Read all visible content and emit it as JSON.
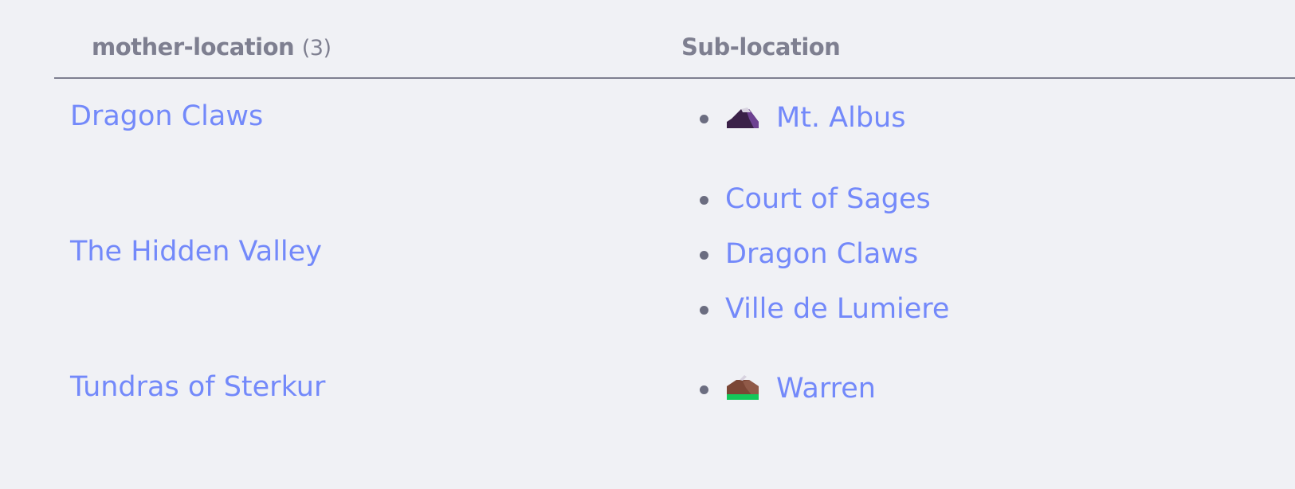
{
  "table": {
    "headers": {
      "mother": "mother-location",
      "mother_count": "(3)",
      "sub": "Sub-location"
    },
    "rows": [
      {
        "mother": "Dragon Claws",
        "subs": [
          {
            "label": "Mt. Albus",
            "icon": "purple-mountain-icon"
          }
        ]
      },
      {
        "mother": "The Hidden Valley",
        "subs": [
          {
            "label": "Court of Sages"
          },
          {
            "label": "Dragon Claws"
          },
          {
            "label": "Ville de Lumiere"
          }
        ]
      },
      {
        "mother": "Tundras of Sterkur",
        "subs": [
          {
            "label": "Warren",
            "icon": "brown-green-mountain-icon"
          }
        ]
      }
    ]
  },
  "colors": {
    "background": "#f0f1f5",
    "link": "#7389fa",
    "header": "#7e7f90",
    "bullet": "#6b6d80"
  }
}
